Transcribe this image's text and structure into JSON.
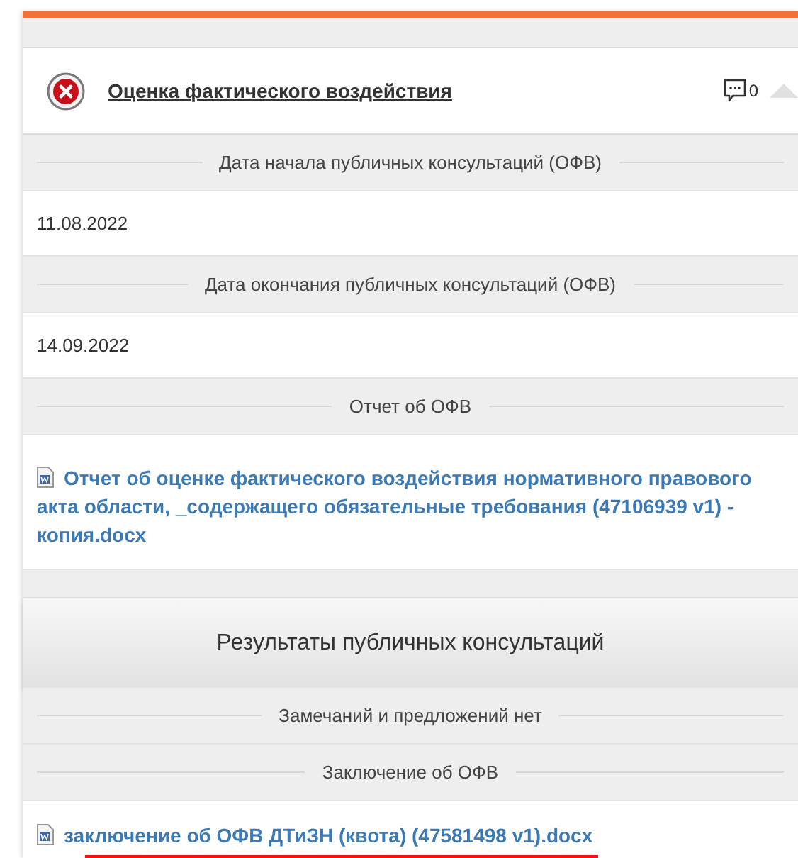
{
  "header": {
    "kind": "error",
    "title": "Оценка фактического воздействия",
    "comments": "0",
    "expanded": true
  },
  "rows": [
    {
      "kind": "caption",
      "text": "Дата начала публичных консультаций (ОФВ)"
    },
    {
      "kind": "value",
      "text": "11.08.2022"
    },
    {
      "kind": "caption",
      "text": "Дата окончания публичных консультаций (ОФВ)"
    },
    {
      "kind": "value",
      "text": "14.09.2022"
    },
    {
      "kind": "caption",
      "text": "Отчет об ОФВ"
    },
    {
      "kind": "file",
      "text": "Отчет об оценке фактического воздействия нормативного правового акта области, _содержащего обязательные требования (47106939 v1) - копия.docx"
    },
    {
      "kind": "gap"
    },
    {
      "kind": "heading",
      "text": "Результаты публичных консультаций"
    },
    {
      "kind": "caption",
      "text": "Замечаний и предложений нет"
    },
    {
      "kind": "caption",
      "text": "Заключение об ОФВ"
    },
    {
      "kind": "file",
      "text": "заключение об ОФВ ДТиЗН (квота) (47581498 v1).docx"
    }
  ]
}
